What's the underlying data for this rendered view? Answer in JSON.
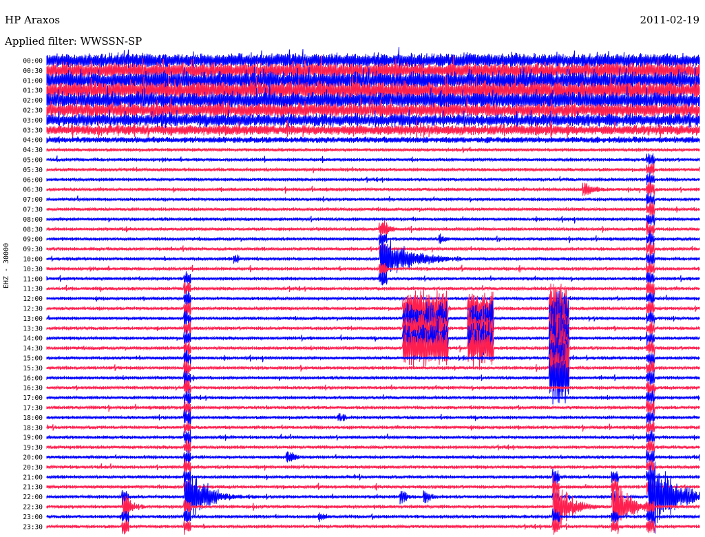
{
  "header": {
    "station": "HP Araxos",
    "date": "2011-02-19",
    "filter": "Applied filter: WWSSN-SP"
  },
  "chart_data": {
    "type": "line",
    "title": "HP Araxos",
    "ylabel": "EHZ - 30000",
    "xlabel": "",
    "categories": [
      "00:00",
      "00:30",
      "01:00",
      "01:30",
      "02:00",
      "02:30",
      "03:00",
      "03:30",
      "04:00",
      "04:30",
      "05:00",
      "05:30",
      "06:00",
      "06:30",
      "07:00",
      "07:30",
      "08:00",
      "08:30",
      "09:00",
      "09:30",
      "10:00",
      "10:30",
      "11:00",
      "11:30",
      "12:00",
      "12:30",
      "13:00",
      "13:30",
      "14:00",
      "14:30",
      "15:00",
      "15:30",
      "16:00",
      "16:30",
      "17:00",
      "17:30",
      "18:00",
      "18:30",
      "19:00",
      "19:30",
      "20:00",
      "20:30",
      "21:00",
      "21:30",
      "22:00",
      "22:30",
      "23:00",
      "23:30"
    ],
    "colors": {
      "even_rows": "#0000ff",
      "odd_rows": "#ff1f4f"
    },
    "grid": false,
    "noise": [
      14,
      15,
      17,
      17,
      16,
      14,
      12,
      10,
      6,
      3,
      3,
      3,
      3,
      3,
      3,
      3,
      3,
      3,
      3,
      3,
      3,
      3,
      3,
      3,
      3,
      3,
      3,
      3,
      3,
      3,
      3,
      3,
      3,
      3,
      3,
      3,
      3,
      3,
      3,
      3,
      3,
      3,
      3,
      3,
      3,
      3,
      3,
      3
    ],
    "events": [
      {
        "row": 13,
        "x": 0.825,
        "amp": 14,
        "decay": 0.02,
        "extent": 0
      },
      {
        "row": 17,
        "x": 0.52,
        "amp": 12,
        "decay": 0.015,
        "extent": 0
      },
      {
        "row": 18,
        "x": 0.605,
        "amp": 10,
        "decay": 0.01,
        "extent": 0
      },
      {
        "row": 20,
        "x": 0.515,
        "amp": 40,
        "decay": 0.05,
        "extent": 3
      },
      {
        "row": 25,
        "x": 0.58,
        "amp": 30,
        "decay": 0.0,
        "extent": 4,
        "burst": 0.035
      },
      {
        "row": 25,
        "x": 0.665,
        "amp": 30,
        "decay": 0.0,
        "extent": 4,
        "burst": 0.02
      },
      {
        "row": 25,
        "x": 0.785,
        "amp": 45,
        "decay": 0.0,
        "extent": 7,
        "burst": 0.015
      },
      {
        "row": 20,
        "x": 0.29,
        "amp": 10,
        "decay": 0.008,
        "extent": 0
      },
      {
        "row": 36,
        "x": 0.45,
        "amp": 10,
        "decay": 0.01,
        "extent": 0
      },
      {
        "row": 40,
        "x": 0.37,
        "amp": 13,
        "decay": 0.012,
        "extent": 0
      },
      {
        "row": 44,
        "x": 0.215,
        "amp": 60,
        "decay": 0.03,
        "extent": 22
      },
      {
        "row": 44,
        "x": 0.925,
        "amp": 70,
        "decay": 0.04,
        "extent": 34
      },
      {
        "row": 44,
        "x": 0.545,
        "amp": 14,
        "decay": 0.012,
        "extent": 0
      },
      {
        "row": 44,
        "x": 0.58,
        "amp": 14,
        "decay": 0.012,
        "extent": 0
      },
      {
        "row": 45,
        "x": 0.12,
        "amp": 22,
        "decay": 0.015,
        "extent": 1
      },
      {
        "row": 45,
        "x": 0.78,
        "amp": 50,
        "decay": 0.025,
        "extent": 3
      },
      {
        "row": 45,
        "x": 0.87,
        "amp": 50,
        "decay": 0.025,
        "extent": 3
      },
      {
        "row": 46,
        "x": 0.42,
        "amp": 10,
        "decay": 0.01,
        "extent": 0
      }
    ]
  }
}
